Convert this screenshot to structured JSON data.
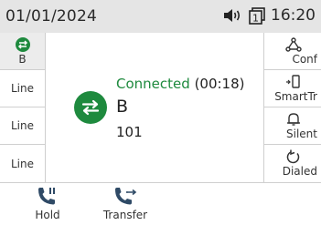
{
  "status_bar": {
    "date": "01/01/2024",
    "time": "16:20",
    "line_indicator": "1"
  },
  "left_keys": [
    {
      "label": "B",
      "icon": "transfer-arrows-icon",
      "active": true
    },
    {
      "label": "Line"
    },
    {
      "label": "Line"
    },
    {
      "label": "Line"
    }
  ],
  "right_keys": [
    {
      "label": "Conf",
      "icon": "conference-icon"
    },
    {
      "label": "SmartTr",
      "icon": "smart-transfer-icon"
    },
    {
      "label": "Silent",
      "icon": "bell-icon"
    },
    {
      "label": "Dialed",
      "icon": "redial-icon"
    }
  ],
  "call": {
    "state": "Connected",
    "duration": "(00:18)",
    "name": "B",
    "number": "101",
    "icon": "transfer-arrows-icon"
  },
  "soft_keys": [
    {
      "label": "Hold",
      "icon": "phone-hold-icon"
    },
    {
      "label": "Transfer",
      "icon": "phone-transfer-icon"
    }
  ],
  "colors": {
    "accent_green": "#1e8a3e",
    "status_bar_bg": "#e5e5e5",
    "divider": "#cfcfcf"
  }
}
